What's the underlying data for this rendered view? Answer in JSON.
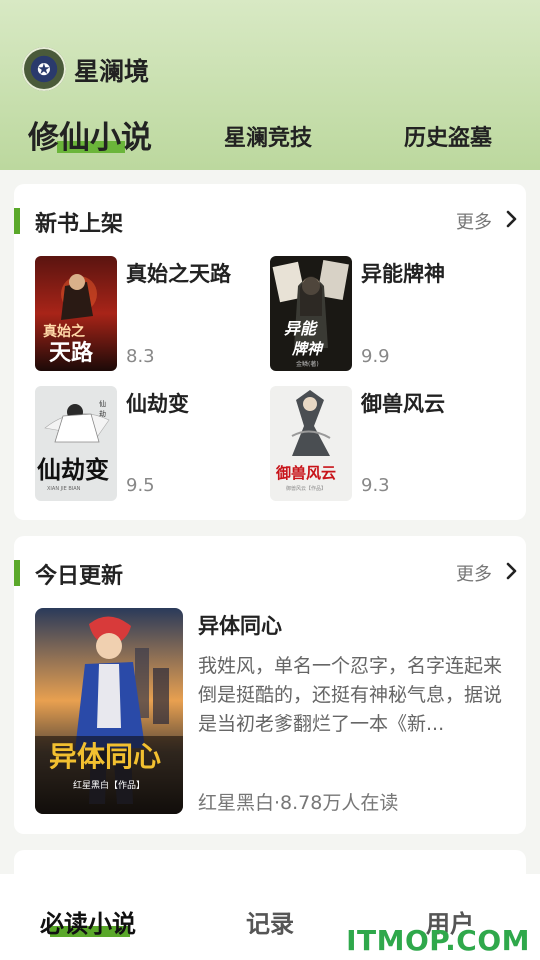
{
  "app": {
    "name": "星澜境"
  },
  "tabs": [
    {
      "label": "修仙小说",
      "active": true
    },
    {
      "label": "星澜竞技",
      "active": false
    },
    {
      "label": "历史盗墓",
      "active": false
    }
  ],
  "new_books": {
    "title": "新书上架",
    "more_label": "更多",
    "books": [
      {
        "title": "真始之天路",
        "score": "8.3",
        "cover_text": "真始之天路"
      },
      {
        "title": "异能牌神",
        "score": "9.9",
        "cover_text": "异能牌神"
      },
      {
        "title": "仙劫变",
        "score": "9.5",
        "cover_text": "仙劫变"
      },
      {
        "title": "御兽风云",
        "score": "9.3",
        "cover_text": "御兽风云"
      }
    ]
  },
  "today_update": {
    "title": "今日更新",
    "more_label": "更多",
    "book": {
      "title": "异体同心",
      "description": "我姓风，单名一个忍字，名字连起来倒是挺酷的，还挺有神秘气息，据说是当初老爹翻烂了一本《新...",
      "meta": "红星黑白·8.78万人在读",
      "cover_title": "异体同心",
      "cover_author": "红星黑白【作品】"
    }
  },
  "bottom_nav": [
    {
      "label": "必读小说",
      "active": true
    },
    {
      "label": "记录",
      "active": false
    },
    {
      "label": "用户",
      "active": false
    }
  ],
  "watermark": "ITMOP.COM",
  "colors": {
    "accent": "#5aa82a",
    "header_top": "#d8e9c4",
    "header_bottom": "#bcd89e"
  }
}
